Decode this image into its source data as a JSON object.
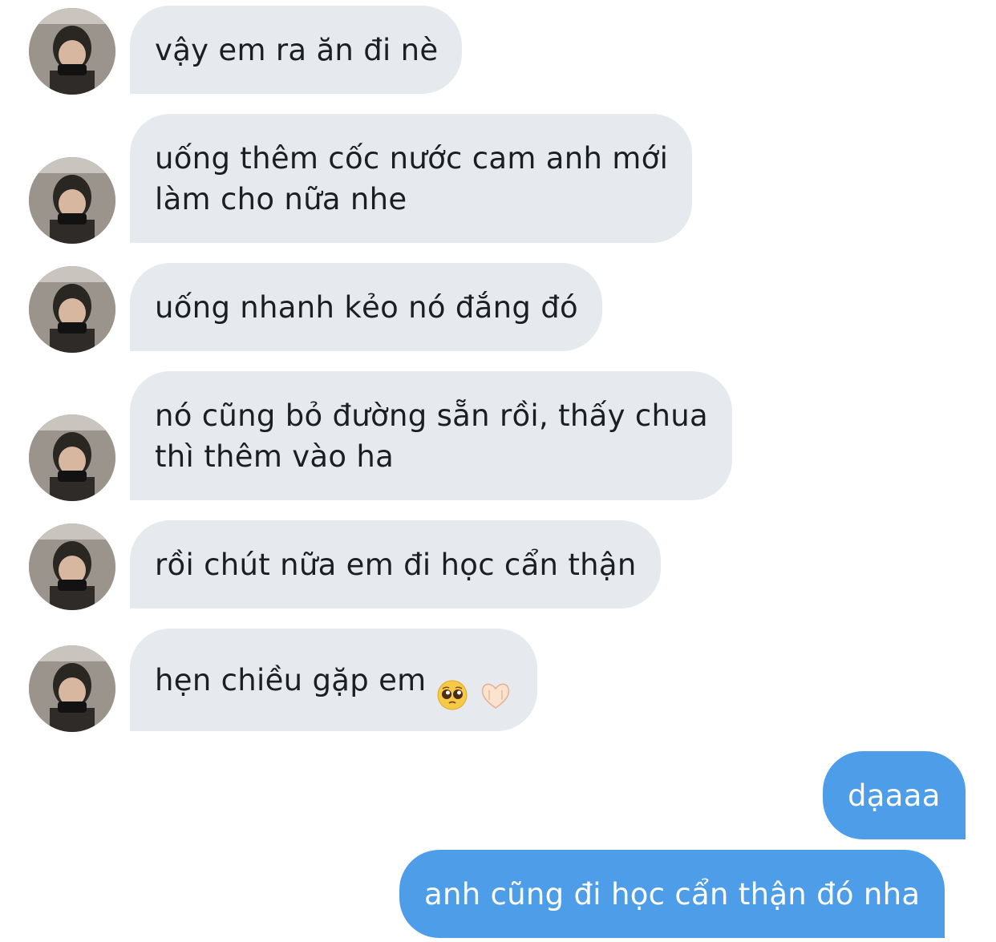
{
  "conversation": {
    "incoming": [
      {
        "text": "vậy em ra ăn đi nè"
      },
      {
        "text": "uống thêm cốc nước cam anh mới\nlàm cho nữa nhe"
      },
      {
        "text": "uống nhanh kẻo nó đắng đó"
      },
      {
        "text": "nó cũng bỏ đường sẵn rồi, thấy chua\nthì thêm vào ha"
      },
      {
        "text": "rồi chút nữa em đi học cẩn thận"
      },
      {
        "text": "hẹn chiều gặp em",
        "emojis": [
          "pleading-face-emoji",
          "heart-hands-emoji"
        ]
      }
    ],
    "outgoing": [
      {
        "text": "dạaaa"
      },
      {
        "text": "anh cũng đi học cẩn thận đó nha"
      }
    ]
  },
  "colors": {
    "incoming_bubble": "#e6e9ee",
    "incoming_text": "#1c1e21",
    "outgoing_bubble": "#4d9de8",
    "outgoing_text": "#ffffff",
    "background": "#ffffff"
  }
}
